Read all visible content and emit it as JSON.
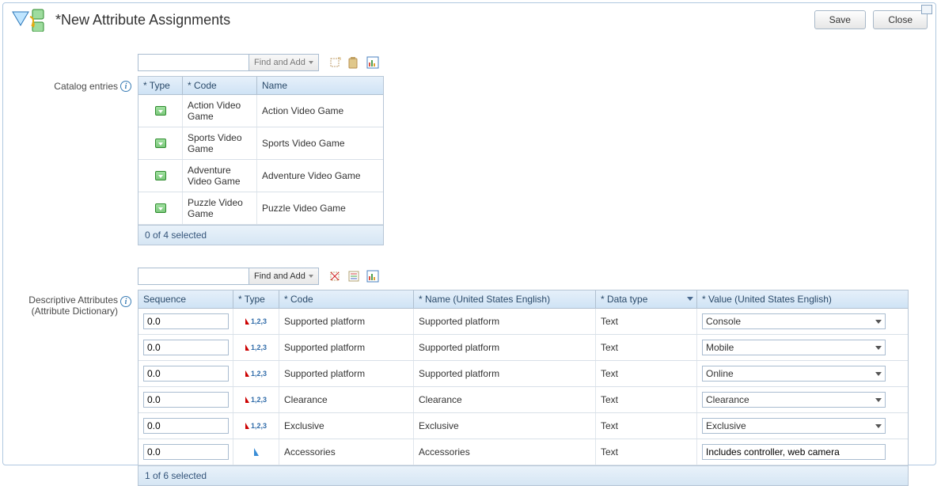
{
  "header": {
    "title": "*New Attribute Assignments",
    "save_label": "Save",
    "close_label": "Close"
  },
  "catalog": {
    "label": "Catalog entries",
    "search_value": "",
    "find_add_label": "Find and Add",
    "columns": {
      "type": "* Type",
      "code": "* Code",
      "name": "Name"
    },
    "rows": [
      {
        "code": "Action Video Game",
        "name": "Action Video Game"
      },
      {
        "code": "Sports Video Game",
        "name": "Sports Video Game"
      },
      {
        "code": "Adventure Video Game",
        "name": "Adventure Video Game"
      },
      {
        "code": "Puzzle Video Game",
        "name": "Puzzle Video Game"
      }
    ],
    "footer": "0 of 4 selected"
  },
  "attributes": {
    "label_line1": "Descriptive Attributes",
    "label_line2": "(Attribute Dictionary)",
    "search_value": "",
    "find_add_label": "Find and Add",
    "columns": {
      "sequence": "Sequence",
      "type": "* Type",
      "code": "* Code",
      "name": "* Name (United States English)",
      "data_type": "* Data type",
      "value": "* Value (United States English)"
    },
    "rows": [
      {
        "sequence": "0.0",
        "type": "enum",
        "code": "Supported platform",
        "name": "Supported platform",
        "data_type": "Text",
        "value": "Console",
        "value_kind": "select"
      },
      {
        "sequence": "0.0",
        "type": "enum",
        "code": "Supported platform",
        "name": "Supported platform",
        "data_type": "Text",
        "value": "Mobile",
        "value_kind": "select"
      },
      {
        "sequence": "0.0",
        "type": "enum",
        "code": "Supported platform",
        "name": "Supported platform",
        "data_type": "Text",
        "value": "Online",
        "value_kind": "select"
      },
      {
        "sequence": "0.0",
        "type": "enum",
        "code": "Clearance",
        "name": "Clearance",
        "data_type": "Text",
        "value": "Clearance",
        "value_kind": "select"
      },
      {
        "sequence": "0.0",
        "type": "enum",
        "code": "Exclusive",
        "name": "Exclusive",
        "data_type": "Text",
        "value": "Exclusive",
        "value_kind": "select"
      },
      {
        "sequence": "0.0",
        "type": "free",
        "code": "Accessories",
        "name": "Accessories",
        "data_type": "Text",
        "value": "Includes controller, web camera",
        "value_kind": "input"
      }
    ],
    "footer": "1 of 6 selected"
  }
}
